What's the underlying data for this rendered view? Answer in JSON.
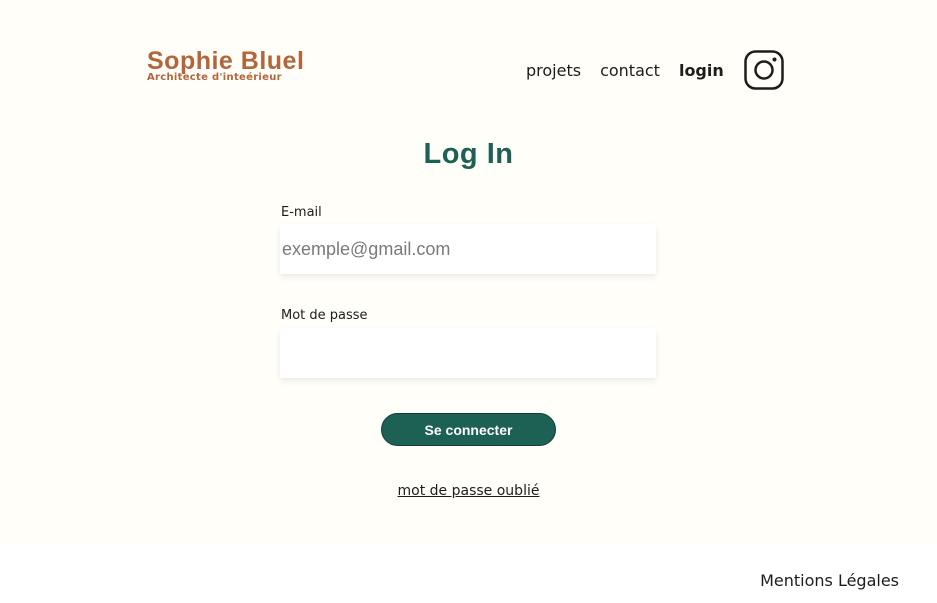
{
  "header": {
    "brand_name": "Sophie Bluel",
    "brand_subtitle": "Architecte d'inteérieur",
    "nav": {
      "projets": "projets",
      "contact": "contact",
      "login": "login"
    },
    "social_icon": "instagram-icon"
  },
  "login_form": {
    "title": "Log In",
    "email_label": "E-mail",
    "email_placeholder": "exemple@gmail.com",
    "email_value": "",
    "password_label": "Mot de passe",
    "password_value": "",
    "submit_label": "Se connecter",
    "forgot_label": "mot de passe oublié"
  },
  "footer": {
    "legal_label": "Mentions Légales"
  },
  "colors": {
    "brand": "#b1663c",
    "accent": "#1d6154",
    "background": "#fffef8"
  }
}
